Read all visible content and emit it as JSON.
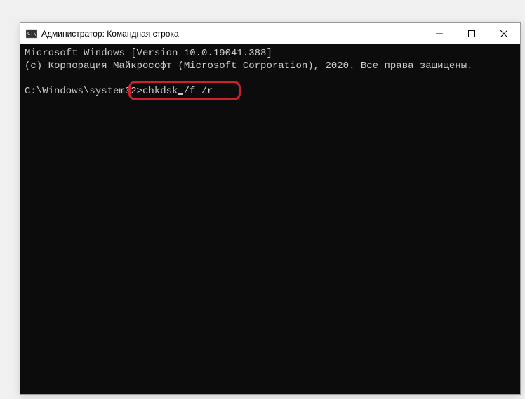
{
  "window": {
    "title": "Администратор: Командная строка"
  },
  "terminal": {
    "line1": "Microsoft Windows [Version 10.0.19041.388]",
    "line2": "(c) Корпорация Майкрософт (Microsoft Corporation), 2020. Все права защищены.",
    "prompt": "C:\\Windows\\system32>",
    "command_part1": "chkdsk",
    "command_part2": "/f /r"
  }
}
